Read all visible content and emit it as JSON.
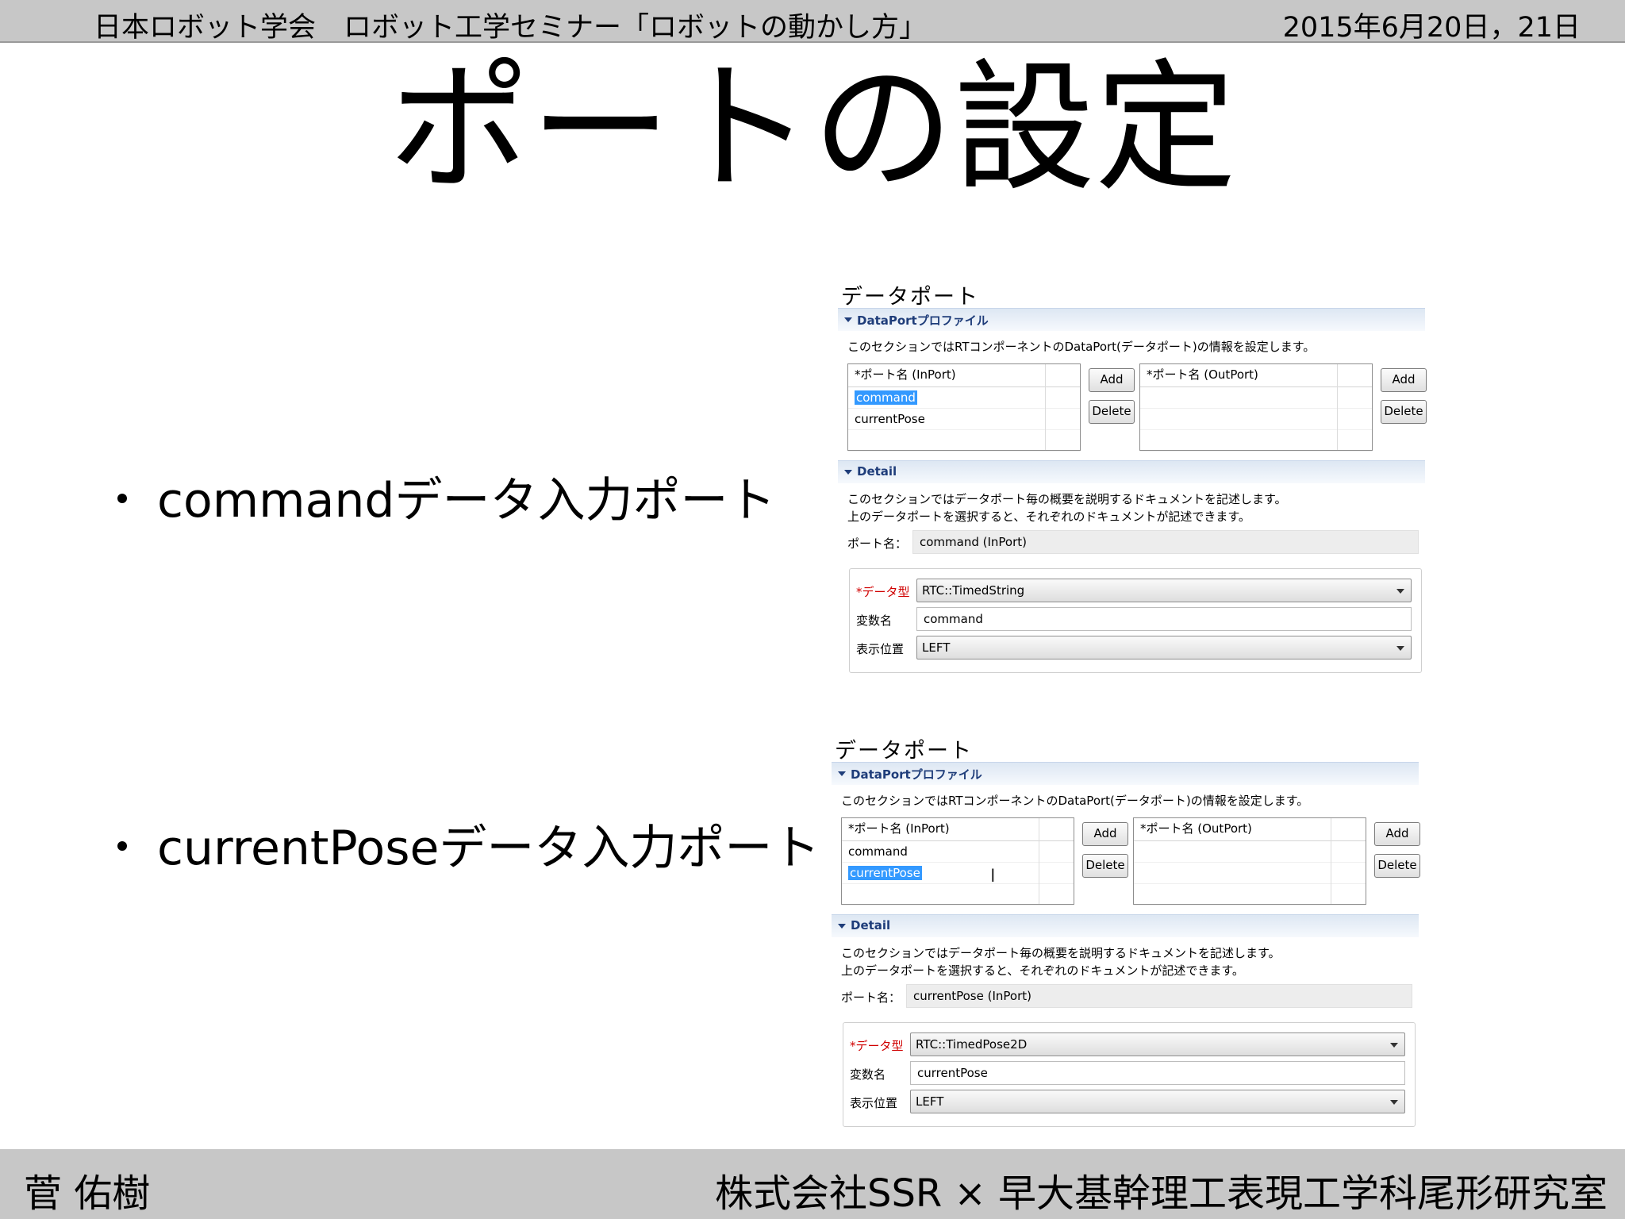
{
  "header": {
    "left": "日本ロボット学会　ロボット工学セミナー「ロボットの動かし方」",
    "right": "2015年6月20日，21日"
  },
  "title": "ポートの設定",
  "bullets": [
    "commandデータ入力ポート",
    "currentPoseデータ入力ポート"
  ],
  "panels": [
    {
      "heading": "データポート",
      "profile_section": "DataPortプロファイル",
      "profile_desc": "このセクションではRTコンポーネントのDataPort(データポート)の情報を設定します。",
      "inport_header": "*ポート名 (InPort)",
      "outport_header": "*ポート名 (OutPort)",
      "inport_rows": [
        "command",
        "currentPose"
      ],
      "selected_index": 0,
      "add_label": "Add",
      "delete_label": "Delete",
      "detail_section": "Detail",
      "detail_desc_1": "このセクションではデータポート毎の概要を説明するドキュメントを記述します。",
      "detail_desc_2": "上のデータポートを選択すると、それぞれのドキュメントが記述できます。",
      "port_name_label": "ポート名：",
      "port_name_value": "command (InPort)",
      "datatype_label": "*データ型",
      "datatype_value": "RTC::TimedString",
      "varname_label": "変数名",
      "varname_value": "command",
      "position_label": "表示位置",
      "position_value": "LEFT"
    },
    {
      "heading": "データポート",
      "profile_section": "DataPortプロファイル",
      "profile_desc": "このセクションではRTコンポーネントのDataPort(データポート)の情報を設定します。",
      "inport_header": "*ポート名 (InPort)",
      "outport_header": "*ポート名 (OutPort)",
      "inport_rows": [
        "command",
        "currentPose"
      ],
      "selected_index": 1,
      "add_label": "Add",
      "delete_label": "Delete",
      "detail_section": "Detail",
      "detail_desc_1": "このセクションではデータポート毎の概要を説明するドキュメントを記述します。",
      "detail_desc_2": "上のデータポートを選択すると、それぞれのドキュメントが記述できます。",
      "port_name_label": "ポート名：",
      "port_name_value": "currentPose (InPort)",
      "datatype_label": "*データ型",
      "datatype_value": "RTC::TimedPose2D",
      "varname_label": "変数名",
      "varname_value": "currentPose",
      "position_label": "表示位置",
      "position_value": "LEFT"
    }
  ],
  "footer": {
    "left": "菅 佑樹",
    "right": "株式会社SSR × 早大基幹理工表現工学科尾形研究室"
  }
}
